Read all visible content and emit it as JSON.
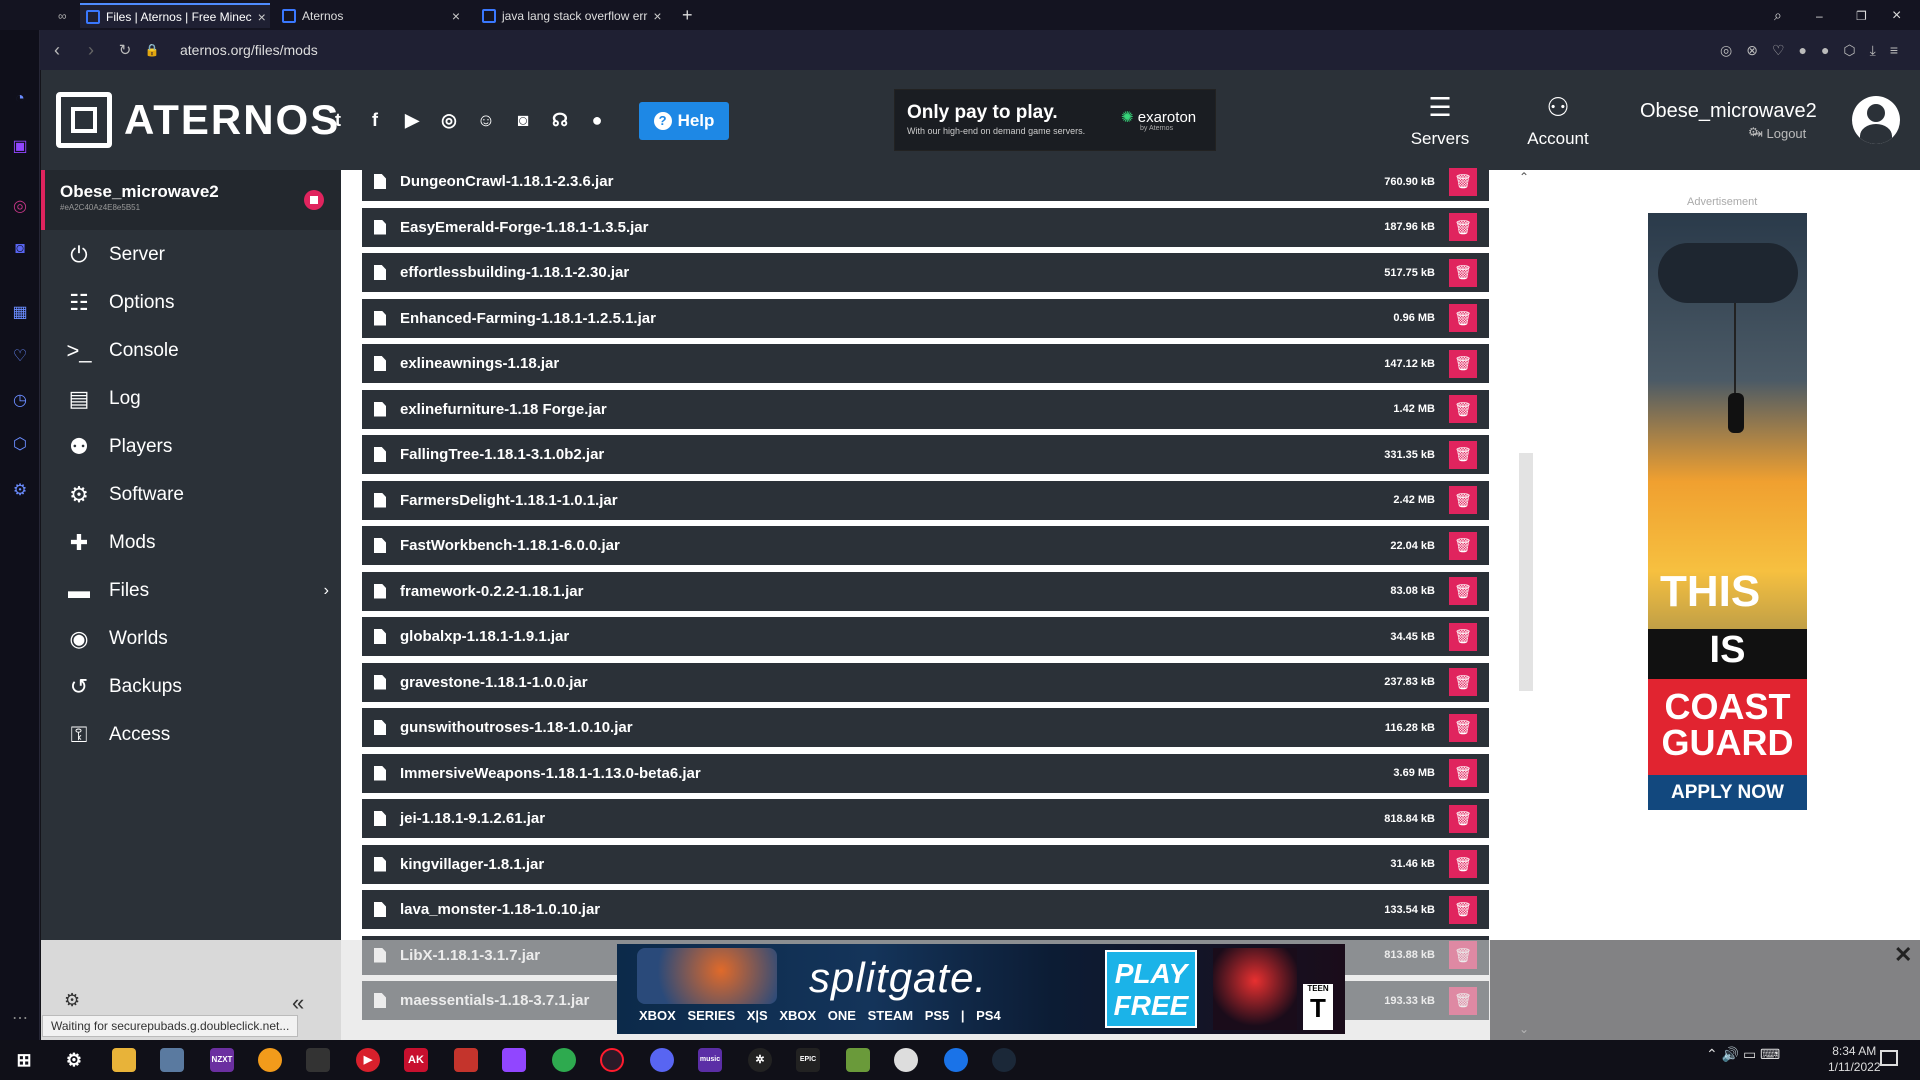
{
  "browser": {
    "tabs": [
      {
        "label": "Files | Aternos | Free Minec",
        "active": true
      },
      {
        "label": "Aternos",
        "active": false
      },
      {
        "label": "java lang stack overflow err",
        "active": false
      }
    ],
    "url": "aternos.org/files/mods",
    "status": "Waiting for securepubads.g.doubleclick.net..."
  },
  "header": {
    "brand": "ATERNOS",
    "help_label": "Help",
    "ad": {
      "headline": "Only pay to play.",
      "subtext": "With our high-end on demand game servers.",
      "brand": "exaroton",
      "brand_sub": "by Aternos"
    },
    "nav": [
      {
        "label": "Servers",
        "icon": "server-stack-icon"
      },
      {
        "label": "Account",
        "icon": "user-gear-icon"
      }
    ],
    "username": "Obese_microwave2",
    "logout_label": "Logout"
  },
  "server": {
    "name": "Obese_microwave2",
    "id": "#eA2C40Az4E8e5B51"
  },
  "menu": [
    {
      "label": "Server",
      "icon": "power-icon"
    },
    {
      "label": "Options",
      "icon": "sliders-icon"
    },
    {
      "label": "Console",
      "icon": "terminal-icon"
    },
    {
      "label": "Log",
      "icon": "document-icon"
    },
    {
      "label": "Players",
      "icon": "users-icon"
    },
    {
      "label": "Software",
      "icon": "gears-icon"
    },
    {
      "label": "Mods",
      "icon": "puzzle-icon"
    },
    {
      "label": "Files",
      "icon": "folder-icon"
    },
    {
      "label": "Worlds",
      "icon": "globe-icon"
    },
    {
      "label": "Backups",
      "icon": "history-icon"
    },
    {
      "label": "Access",
      "icon": "user-lock-icon"
    }
  ],
  "files": [
    {
      "name": "DungeonCrawl-1.18.1-2.3.6.jar",
      "size": "760.90 kB"
    },
    {
      "name": "EasyEmerald-Forge-1.18.1-1.3.5.jar",
      "size": "187.96 kB"
    },
    {
      "name": "effortlessbuilding-1.18.1-2.30.jar",
      "size": "517.75 kB"
    },
    {
      "name": "Enhanced-Farming-1.18.1-1.2.5.1.jar",
      "size": "0.96 MB"
    },
    {
      "name": "exlineawnings-1.18.jar",
      "size": "147.12 kB"
    },
    {
      "name": "exlinefurniture-1.18 Forge.jar",
      "size": "1.42 MB"
    },
    {
      "name": "FallingTree-1.18.1-3.1.0b2.jar",
      "size": "331.35 kB"
    },
    {
      "name": "FarmersDelight-1.18.1-1.0.1.jar",
      "size": "2.42 MB"
    },
    {
      "name": "FastWorkbench-1.18.1-6.0.0.jar",
      "size": "22.04 kB"
    },
    {
      "name": "framework-0.2.2-1.18.1.jar",
      "size": "83.08 kB"
    },
    {
      "name": "globalxp-1.18.1-1.9.1.jar",
      "size": "34.45 kB"
    },
    {
      "name": "gravestone-1.18.1-1.0.0.jar",
      "size": "237.83 kB"
    },
    {
      "name": "gunswithoutroses-1.18-1.0.10.jar",
      "size": "116.28 kB"
    },
    {
      "name": "ImmersiveWeapons-1.18.1-1.13.0-beta6.jar",
      "size": "3.69 MB"
    },
    {
      "name": "jei-1.18.1-9.1.2.61.jar",
      "size": "818.84 kB"
    },
    {
      "name": "kingvillager-1.8.1.jar",
      "size": "31.46 kB"
    },
    {
      "name": "lava_monster-1.18-1.0.10.jar",
      "size": "133.54 kB"
    },
    {
      "name": "LibX-1.18.1-3.1.7.jar",
      "size": "813.88 kB"
    },
    {
      "name": "maessentials-1.18-3.7.1.jar",
      "size": "193.33 kB"
    }
  ],
  "ads": {
    "right_label": "Advertisement",
    "right": {
      "line1": "THIS",
      "line2": "IS",
      "line3": "COAST GUARD",
      "cta": "APPLY NOW"
    },
    "bottom": {
      "title": "splitgate.",
      "platforms": "XBOX SERIES X|S  XBOX ONE  STEAM  PS5 | PS4",
      "cta": "PLAY FREE",
      "rating": "TEEN",
      "rating_letter": "T"
    }
  },
  "taskbar": {
    "time": "8:34 AM",
    "date": "1/11/2022"
  }
}
